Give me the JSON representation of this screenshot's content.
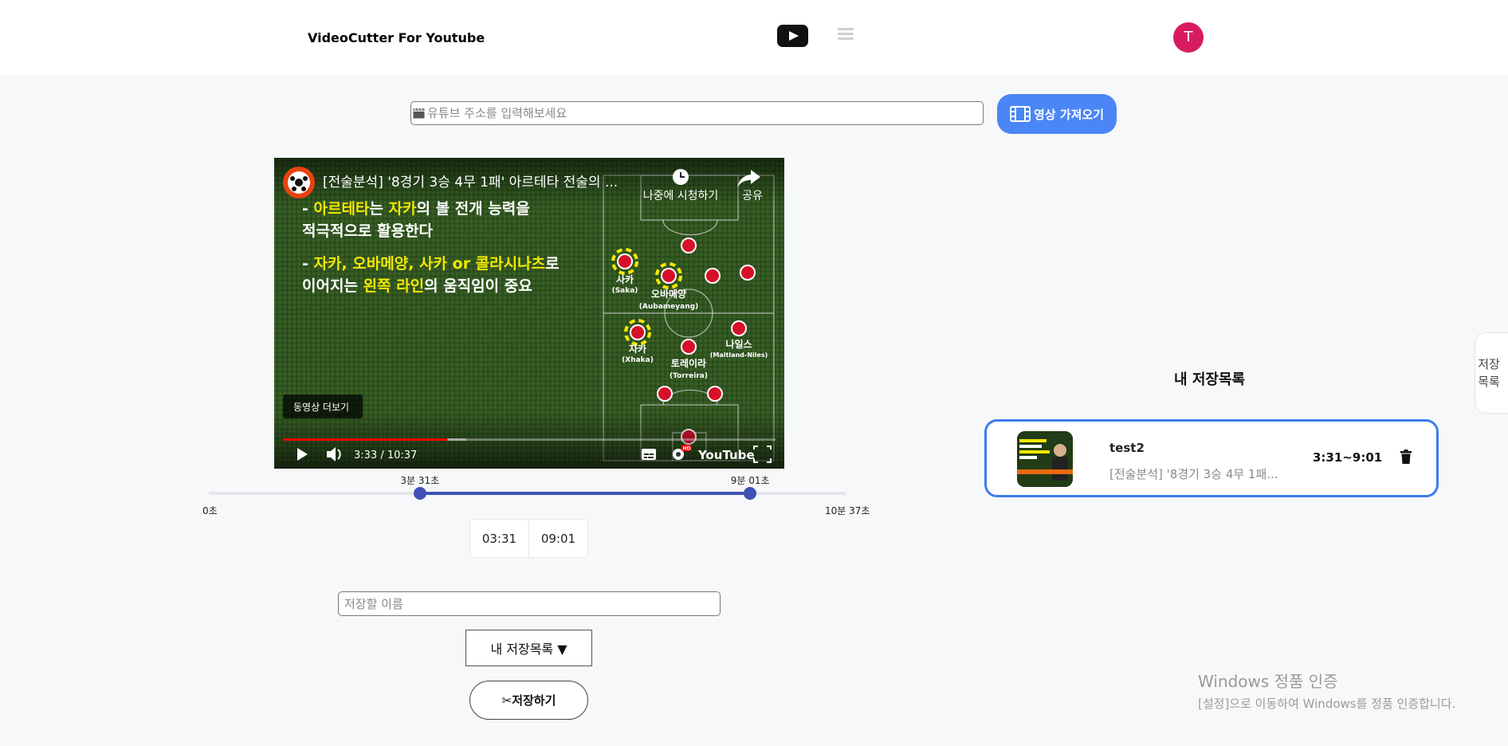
{
  "header": {
    "brand": "VideoCutter For Youtube",
    "avatar_letter": "T"
  },
  "search": {
    "placeholder": "유튜브 주소를 입력해보세요",
    "fetch_label": "영상 가져오기"
  },
  "video": {
    "title": "[전술분석] '8경기 3승 4무 1패' 아르테타 전술의 ...",
    "watch_later": "나중에 시청하기",
    "share": "공유",
    "more_videos": "동영상 더보기",
    "time_display": "3:33 / 10:37",
    "youtube_logo": "YouTube",
    "progress": 0.334,
    "slide": {
      "bullet1_parts": [
        "- ",
        "아르테타",
        "는 ",
        "자카",
        "의 볼 전개 능력을"
      ],
      "bullet1_line2": "적극적으로 활용한다",
      "bullet2_parts": [
        "- ",
        "자카, 오바메양, 사카 or 콜라시나츠",
        "로"
      ],
      "bullet2_line2_parts": [
        "이어지는 ",
        "왼쪽 라인",
        "의 움직임이 중요"
      ],
      "players": [
        {
          "ko": "사카",
          "en": "(Saka)"
        },
        {
          "ko": "오바메양",
          "en": "(Aubameyang)"
        },
        {
          "ko": "자카",
          "en": "(Xhaka)"
        },
        {
          "ko": "토레이라",
          "en": "(Torreira)"
        },
        {
          "ko": "나일스",
          "en": "(Maitland-Niles)"
        }
      ]
    }
  },
  "slider": {
    "start_label": "3분 31초",
    "end_label": "9분 01초",
    "min_label": "0초",
    "max_label": "10분 37초",
    "start_fraction": 0.331,
    "end_fraction": 0.849
  },
  "times": {
    "start": "03:31",
    "end": "09:01"
  },
  "save_form": {
    "name_placeholder": "저장할 이름",
    "list_select": "내 저장목록 ▼",
    "save_label": "저장하기"
  },
  "saved": {
    "title": "내 저장목록",
    "items": [
      {
        "name": "test2",
        "desc": "[전술분석] '8경기 3승 4무 1패...",
        "range": "3:31~9:01",
        "thumb_text": "이 두 가지 능력으로 상대를 무너뜨리는 자카 활용법"
      }
    ]
  },
  "side_tab": {
    "line1": "저장",
    "line2": "목록"
  },
  "watermark": {
    "line1": "Windows 정품 인증",
    "line2": "[설정]으로 이동하여 Windows를 정품 인증합니다."
  },
  "colors": {
    "accent": "#4a86f5",
    "slider": "#3f51b5",
    "avatar": "#d81b60",
    "highlight": "#f3e800"
  }
}
